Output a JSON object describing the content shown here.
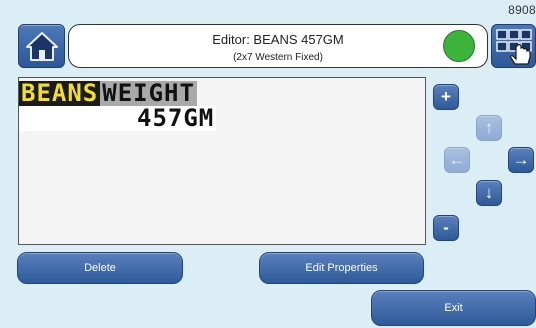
{
  "header": {
    "corner_id": "8908",
    "title": "Editor: BEANS 457GM",
    "subtitle": "(2x7 Western Fixed)",
    "status_color": "#3bb43b"
  },
  "message": {
    "line1": [
      "BEANS",
      "WEIGHT"
    ],
    "line2": "457GM",
    "segment_colors": {
      "beans_bg": "#1b1b1b",
      "beans_fg": "#f3df2b",
      "weight_bg": "#a9a9a9"
    }
  },
  "controls": {
    "plus": "+",
    "minus": "-",
    "up": "↑",
    "down": "↓",
    "left": "←",
    "right": "→"
  },
  "buttons": {
    "delete": "Delete",
    "edit_properties": "Edit Properties",
    "exit": "Exit"
  },
  "icons": {
    "home": "home-icon",
    "grid": "grid-select-icon",
    "hand": "hand-pointer-icon"
  }
}
